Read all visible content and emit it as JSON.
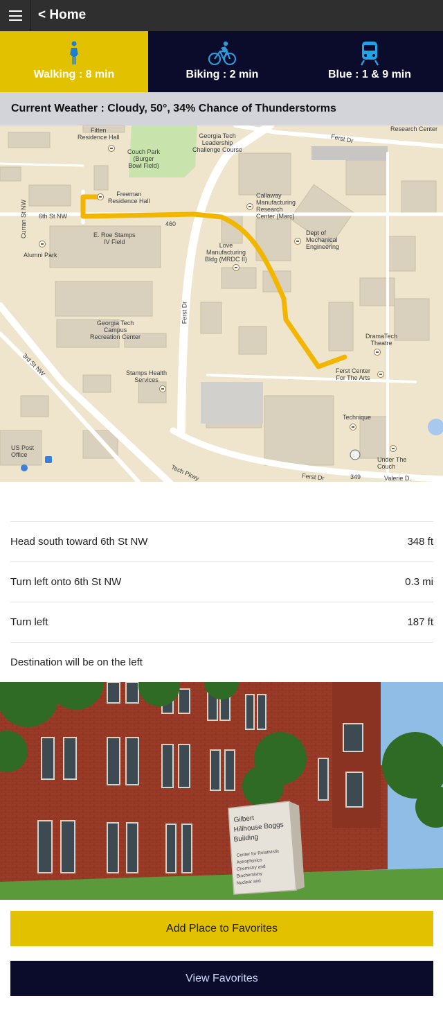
{
  "header": {
    "back_label": "< Home",
    "menu_icon": "hamburger-icon"
  },
  "modes": [
    {
      "label": "Walking : 8 min",
      "icon": "walking-icon",
      "selected": true
    },
    {
      "label": "Biking : 2 min",
      "icon": "bicycle-icon",
      "selected": false
    },
    {
      "label": "Blue : 1 & 9 min",
      "icon": "train-icon",
      "selected": false
    }
  ],
  "weather": {
    "text": "Current Weather : Cloudy, 50°, 34% Chance of Thunderstorms"
  },
  "map": {
    "labels": {
      "fitten": "Fitten\nResidence Hall",
      "couch_park": "Couch Park\n(Burger\nBowl Field)",
      "leadership": "Georgia Tech\nLeadership\nChallenge Course",
      "ferst_dr_top": "Ferst Dr",
      "research_center": "Research Center",
      "freeman": "Freeman\nResidence Hall",
      "sixth_st": "6th St NW",
      "curran": "Curran St NW",
      "callaway": "Callaway\nManufacturing\nResearch\nCenter (Marc)",
      "roe_stamps": "E. Roe Stamps\nIV Field",
      "alumni_park": "Alumni Park",
      "love_mfg": "Love\nManufacturing\nBldg (MRDC II)",
      "dept_mech": "Dept of\nMechanical\nEngineering",
      "route_460": "460",
      "ferst_dr_mid": "Ferst Dr",
      "crc": "Georgia Tech\nCampus\nRecreation Center",
      "dramatech": "DramaTech\nTheatre",
      "ferst_center": "Ferst Center\nFor The Arts",
      "third_st": "3rd St NW",
      "stamps_health": "Stamps Health\nServices",
      "technique": "Technique",
      "us_post": "US Post\nOffice",
      "under_couch": "Under The\nCouch",
      "tech_pkwy": "Tech Pkwy",
      "ferst_dr_bottom": "Ferst Dr",
      "route_349": "349",
      "valerie": "Valerie D."
    },
    "route_color": "#f2b600"
  },
  "directions": [
    {
      "text": "Head south toward 6th St NW",
      "distance": "348 ft"
    },
    {
      "text": "Turn left onto 6th St NW",
      "distance": "0.3 mi"
    },
    {
      "text": "Turn left",
      "distance": "187 ft"
    },
    {
      "text": "Destination will be on the left",
      "distance": ""
    }
  ],
  "photo": {
    "sign_text": "Gilbert\nHillhouse Boggs\nBuilding",
    "sign_subtext": "Center for Relativistic\nAstrophysics\nChemistry and\nBiochemistry\nNuclear and"
  },
  "buttons": {
    "add_favorite": "Add Place to Favorites",
    "view_favorites": "View Favorites"
  },
  "colors": {
    "accent_yellow": "#e2c200",
    "navy": "#0b0b2c",
    "bike_icon_blue": "#2f9ad8",
    "train_icon_blue": "#22a3e6",
    "walk_icon_blue": "#1e7fd1"
  }
}
